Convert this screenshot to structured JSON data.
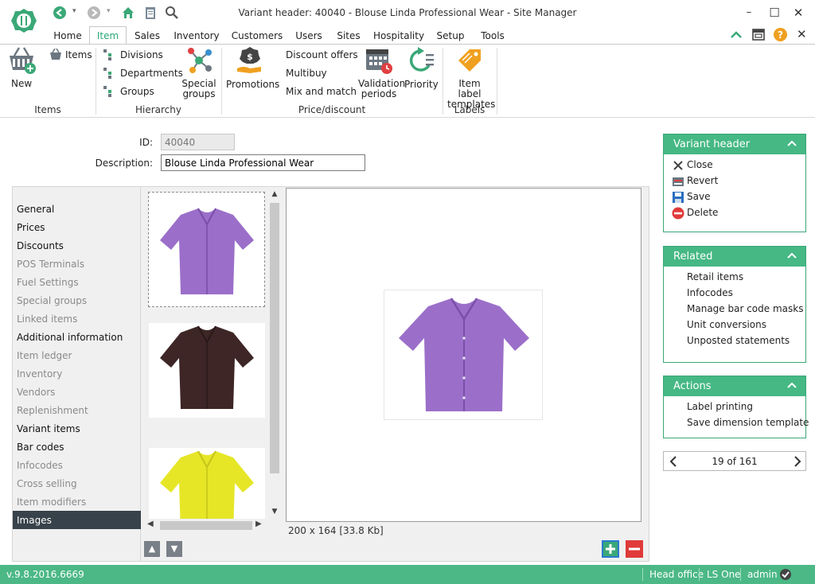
{
  "window": {
    "title": "Variant header: 40040 - Blouse Linda Professional Wear - Site Manager",
    "minimize": "–",
    "maximize": "☐",
    "close": "✕"
  },
  "ribbon_tabs": [
    "Home",
    "Item",
    "Sales",
    "Inventory",
    "Customers",
    "Users",
    "Sites",
    "Hospitality",
    "Setup",
    "Tools"
  ],
  "active_tab": "Item",
  "ribbon": {
    "new_label": "New",
    "items_label": "Items",
    "divisions_label": "Divisions",
    "departments_label": "Departments",
    "groups_label": "Groups",
    "special_groups_label": "Special groups",
    "promotions_label": "Promotions",
    "discount_offers_label": "Discount offers",
    "multibuy_label": "Multibuy",
    "mix_and_match_label": "Mix and match",
    "validation_periods_label": "Validation periods",
    "priority_label": "Priority",
    "item_label_templates_label": "Item label templates",
    "group_items": "Items",
    "group_hierarchy": "Hierarchy",
    "group_price_discount": "Price/discount",
    "group_labels": "Labels"
  },
  "form": {
    "id_label": "ID:",
    "id_value": "40040",
    "description_label": "Description:",
    "description_value": "Blouse Linda Professional Wear"
  },
  "left_nav": [
    {
      "label": "General",
      "state": "strong"
    },
    {
      "label": "Prices",
      "state": "strong"
    },
    {
      "label": "Discounts",
      "state": "strong"
    },
    {
      "label": "POS Terminals",
      "state": "dim"
    },
    {
      "label": "Fuel Settings",
      "state": "dim"
    },
    {
      "label": "Special groups",
      "state": "dim"
    },
    {
      "label": "Linked items",
      "state": "dim"
    },
    {
      "label": "Additional information",
      "state": "strong"
    },
    {
      "label": "Item ledger",
      "state": "dim"
    },
    {
      "label": "Inventory",
      "state": "dim"
    },
    {
      "label": "Vendors",
      "state": "dim"
    },
    {
      "label": "Replenishment",
      "state": "dim"
    },
    {
      "label": "Variant items",
      "state": "strong"
    },
    {
      "label": "Bar codes",
      "state": "strong"
    },
    {
      "label": "Infocodes",
      "state": "dim"
    },
    {
      "label": "Cross selling",
      "state": "dim"
    },
    {
      "label": "Item modifiers",
      "state": "dim"
    },
    {
      "label": "Images",
      "state": "active"
    }
  ],
  "images": {
    "thumb_colors": [
      "#9b6fc9",
      "#3e2626",
      "#e6e627"
    ],
    "preview_color": "#9b6fc9",
    "image_info": "200 x 164 [33.8 Kb]"
  },
  "panels": {
    "variant_header": {
      "title": "Variant header",
      "actions": [
        "Close",
        "Revert",
        "Save",
        "Delete"
      ]
    },
    "related": {
      "title": "Related",
      "links": [
        "Retail items",
        "Infocodes",
        "Manage bar code masks",
        "Unit conversions",
        "Unposted statements"
      ]
    },
    "actions": {
      "title": "Actions",
      "links": [
        "Label printing",
        "Save dimension template"
      ]
    }
  },
  "pager": {
    "text": "19 of 161"
  },
  "statusbar": {
    "version": "v.9.8.2016.6669",
    "site": "Head office",
    "product": "LS One",
    "user": "admin"
  },
  "colors": {
    "accent": "#45b884",
    "nav_active": "#37424a"
  }
}
